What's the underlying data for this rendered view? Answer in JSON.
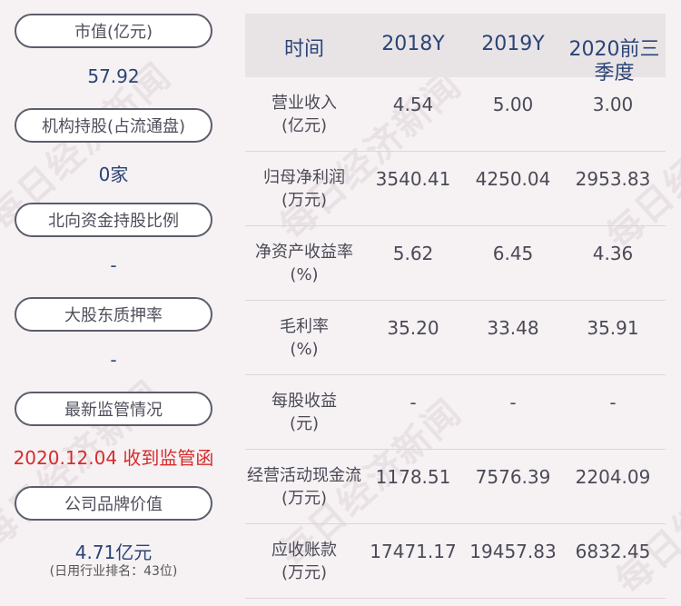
{
  "left_panel": {
    "market_cap_label": "市值(亿元)",
    "market_cap_value": "57.92",
    "institution_label": "机构持股(占流通盘)",
    "institution_value": "0家",
    "northbound_label": "北向资金持股比例",
    "northbound_value": "-",
    "pledge_label": "大股东质押率",
    "pledge_value": "-",
    "regulatory_label": "最新监管情况",
    "regulatory_value": "2020.12.04 收到监管函",
    "brand_label": "公司品牌价值",
    "brand_value": "4.71亿元",
    "brand_rank": "(日用行业排名：43位)"
  },
  "table": {
    "headers": [
      "时间",
      "2018Y",
      "2019Y",
      "2020前三",
      "季度"
    ],
    "rows": [
      {
        "label1": "营业收入",
        "label2": "(亿元)",
        "values": [
          "4.54",
          "5.00",
          "3.00"
        ]
      },
      {
        "label1": "归母净利润",
        "label2": "(万元)",
        "values": [
          "3540.41",
          "4250.04",
          "2953.83"
        ]
      },
      {
        "label1": "净资产收益率",
        "label2": "(%)",
        "values": [
          "5.62",
          "6.45",
          "4.36"
        ]
      },
      {
        "label1": "毛利率",
        "label2": "(%)",
        "values": [
          "35.20",
          "33.48",
          "35.91"
        ]
      },
      {
        "label1": "每股收益",
        "label2": "(元)",
        "values": [
          "-",
          "-",
          "-"
        ]
      },
      {
        "label1": "经营活动现金流",
        "label2": "(万元)",
        "values": [
          "1178.51",
          "7576.39",
          "2204.09"
        ]
      },
      {
        "label1": "应收账款",
        "label2": "(万元)",
        "values": [
          "17471.17",
          "19457.83",
          "6832.45"
        ]
      }
    ]
  },
  "watermark_text": "每日经济新闻",
  "colors": {
    "accent_blue": "#2b4476",
    "alert_red": "#d42c2c",
    "pill_border": "#5d5d6b"
  }
}
